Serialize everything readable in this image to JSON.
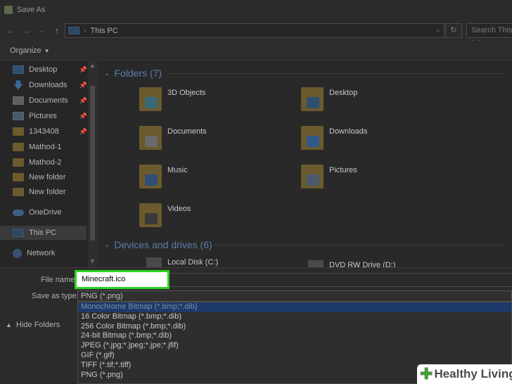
{
  "window": {
    "title": "Save As"
  },
  "address": {
    "crumb": "This PC",
    "search_placeholder": "Search This PC"
  },
  "toolbar": {
    "organize_label": "Organize"
  },
  "nav": {
    "items": [
      {
        "label": "Desktop",
        "icon": "desktop-icon",
        "pinned": true
      },
      {
        "label": "Downloads",
        "icon": "download-icon",
        "pinned": true
      },
      {
        "label": "Documents",
        "icon": "documents-icon",
        "pinned": true
      },
      {
        "label": "Pictures",
        "icon": "pictures-icon",
        "pinned": true
      },
      {
        "label": "1343408",
        "icon": "folder-icon",
        "pinned": true
      },
      {
        "label": "Mathod-1",
        "icon": "folder-icon",
        "pinned": false
      },
      {
        "label": "Mathod-2",
        "icon": "folder-icon",
        "pinned": false
      },
      {
        "label": "New folder",
        "icon": "folder-icon",
        "pinned": false
      },
      {
        "label": "New folder",
        "icon": "folder-icon",
        "pinned": false
      }
    ],
    "onedrive": "OneDrive",
    "thispc": "This PC",
    "network": "Network"
  },
  "content": {
    "folders_header": "Folders (7)",
    "folders": [
      "3D Objects",
      "Desktop",
      "Documents",
      "Downloads",
      "Music",
      "Pictures",
      "Videos"
    ],
    "drives_header": "Devices and drives (6)",
    "drives": [
      "Local Disk (C:)",
      "DVD RW Drive (D:)"
    ]
  },
  "form": {
    "file_name_label": "File name:",
    "file_name_value": "Minecraft.ico",
    "save_type_label": "Save as type:",
    "save_type_value": "PNG (*.png)",
    "hide_folders": "Hide Folders",
    "type_options": [
      "Monochrome Bitmap (*.bmp;*.dib)",
      "16 Color Bitmap (*.bmp;*.dib)",
      "256 Color Bitmap (*.bmp;*.dib)",
      "24-bit Bitmap (*.bmp;*.dib)",
      "JPEG (*.jpg;*.jpeg;*.jpe;*.jfif)",
      "GIF (*.gif)",
      "TIFF (*.tif;*.tiff)",
      "PNG (*.png)"
    ],
    "highlighted_index": 0
  },
  "colors": {
    "highlight_border": "#2ed321",
    "accent": "#5a7faa"
  },
  "watermark": {
    "text": "Healthy Living"
  }
}
